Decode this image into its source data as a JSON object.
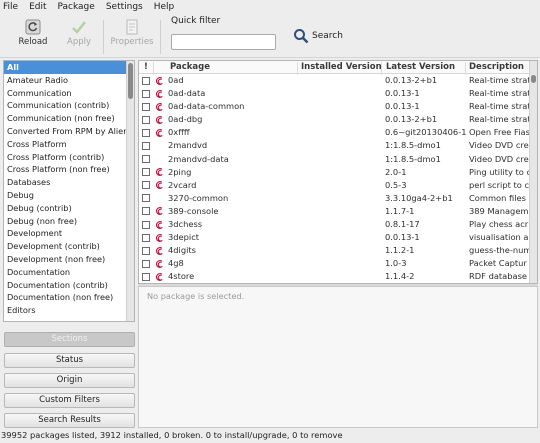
{
  "menu": [
    "File",
    "Edit",
    "Package",
    "Settings",
    "Help"
  ],
  "toolbar": {
    "reload_label": "Reload",
    "apply_label": "Apply",
    "properties_label": "Properties",
    "quick_filter_label": "Quick filter",
    "quick_filter_value": "",
    "search_label": "Search"
  },
  "sections": [
    "All",
    "Amateur Radio",
    "Communication",
    "Communication (contrib)",
    "Communication (non free)",
    "Converted From RPM by Alien",
    "Cross Platform",
    "Cross Platform (contrib)",
    "Cross Platform (non free)",
    "Databases",
    "Debug",
    "Debug (contrib)",
    "Debug (non free)",
    "Development",
    "Development (contrib)",
    "Development (non free)",
    "Documentation",
    "Documentation (contrib)",
    "Documentation (non free)",
    "Editors"
  ],
  "selected_section": "All",
  "filter_buttons": {
    "sections": "Sections",
    "status": "Status",
    "origin": "Origin",
    "custom_filters": "Custom Filters",
    "search_results": "Search Results"
  },
  "table": {
    "columns": {
      "status": "!",
      "package": "Package",
      "installed": "Installed Version",
      "latest": "Latest Version",
      "description": "Description"
    },
    "rows": [
      {
        "name": "0ad",
        "installed": "",
        "latest": "0.0.13-2+b1",
        "desc": "Real-time strat",
        "debian": true
      },
      {
        "name": "0ad-data",
        "installed": "",
        "latest": "0.0.13-1",
        "desc": "Real-time strat",
        "debian": true
      },
      {
        "name": "0ad-data-common",
        "installed": "",
        "latest": "0.0.13-1",
        "desc": "Real-time strat",
        "debian": true
      },
      {
        "name": "0ad-dbg",
        "installed": "",
        "latest": "0.0.13-2+b1",
        "desc": "Real-time strat",
        "debian": true
      },
      {
        "name": "0xffff",
        "installed": "",
        "latest": "0.6~git20130406-1",
        "desc": "Open Free Fias",
        "debian": true
      },
      {
        "name": "2mandvd",
        "installed": "",
        "latest": "1:1.8.5-dmo1",
        "desc": "Video DVD cre",
        "debian": false
      },
      {
        "name": "2mandvd-data",
        "installed": "",
        "latest": "1:1.8.5-dmo1",
        "desc": "Video DVD cre",
        "debian": false
      },
      {
        "name": "2ping",
        "installed": "",
        "latest": "2.0-1",
        "desc": "Ping utility to c",
        "debian": true
      },
      {
        "name": "2vcard",
        "installed": "",
        "latest": "0.5-3",
        "desc": "perl script to c",
        "debian": true
      },
      {
        "name": "3270-common",
        "installed": "",
        "latest": "3.3.10ga4-2+b1",
        "desc": "Common files",
        "debian": false
      },
      {
        "name": "389-console",
        "installed": "",
        "latest": "1.1.7-1",
        "desc": "389 Managem",
        "debian": true
      },
      {
        "name": "3dchess",
        "installed": "",
        "latest": "0.8.1-17",
        "desc": "Play chess acr",
        "debian": true
      },
      {
        "name": "3depict",
        "installed": "",
        "latest": "0.0.13-1",
        "desc": "visualisation ar",
        "debian": true
      },
      {
        "name": "4digits",
        "installed": "",
        "latest": "1.1.2-1",
        "desc": "guess-the-num",
        "debian": true
      },
      {
        "name": "4g8",
        "installed": "",
        "latest": "1.0-3",
        "desc": "Packet Captur",
        "debian": true
      },
      {
        "name": "4store",
        "installed": "",
        "latest": "1.1.4-2",
        "desc": "RDF database",
        "debian": true
      }
    ]
  },
  "details_text": "No package is selected.",
  "status_text": "39952 packages listed, 3912 installed, 0 broken. 0 to install/upgrade, 0 to remove"
}
